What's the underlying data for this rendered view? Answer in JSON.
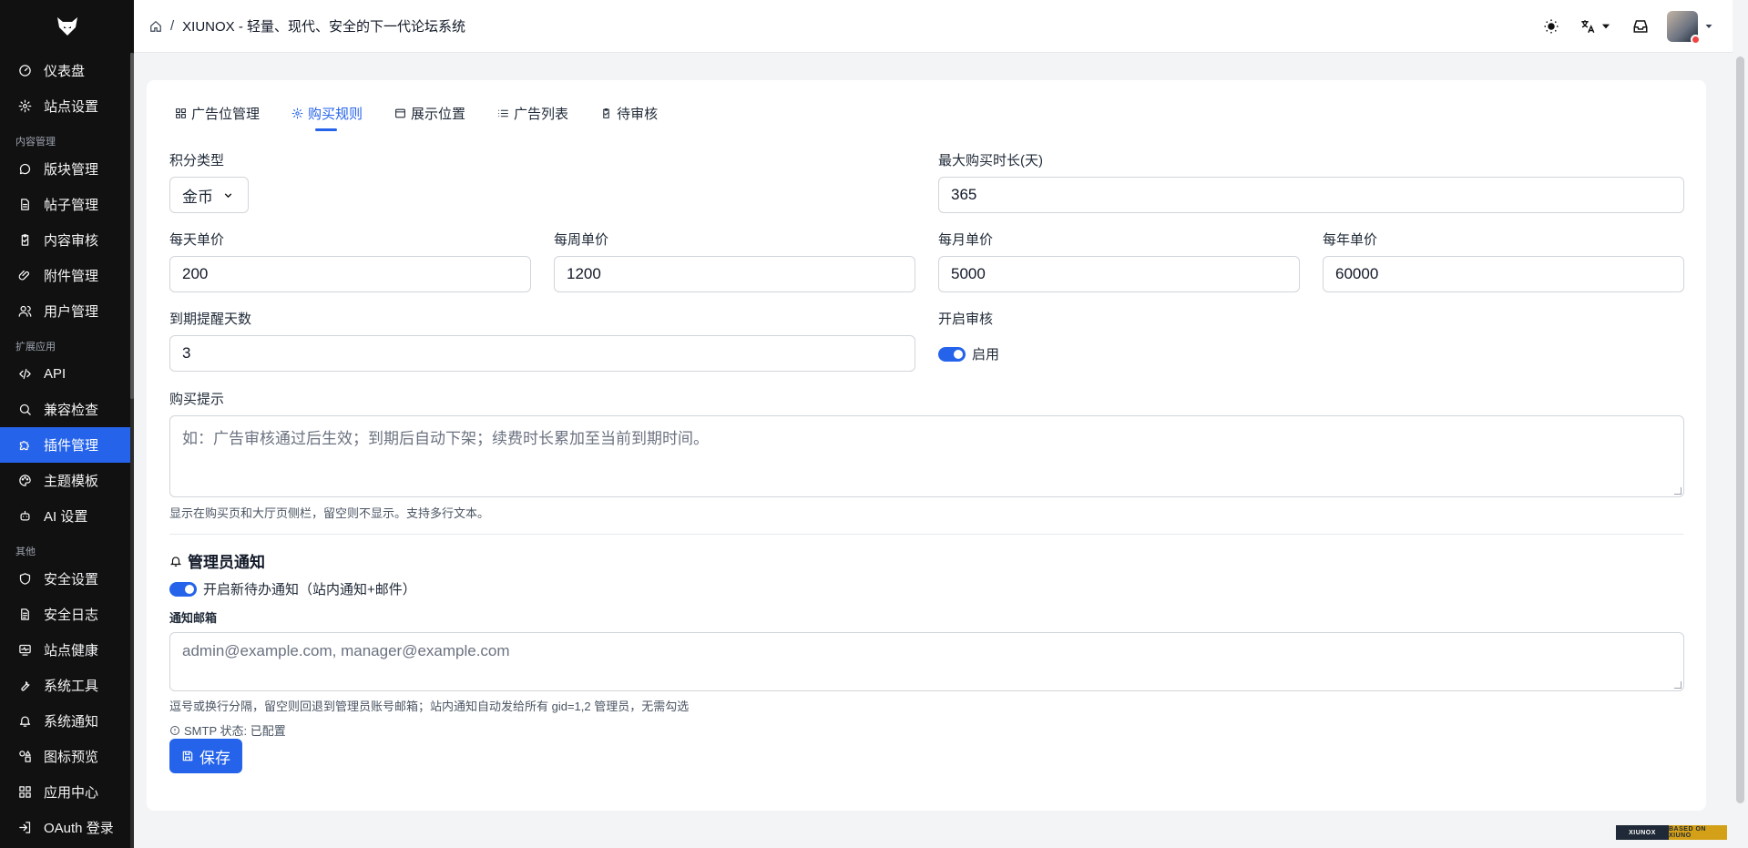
{
  "sidebar": {
    "items_top": [
      {
        "label": "仪表盘",
        "icon": "dashboard-icon"
      },
      {
        "label": "站点设置",
        "icon": "gear-icon"
      }
    ],
    "group_content": "内容管理",
    "items_content": [
      {
        "label": "版块管理",
        "icon": "chat-bubble-icon"
      },
      {
        "label": "帖子管理",
        "icon": "document-icon"
      },
      {
        "label": "内容审核",
        "icon": "clipboard-check-icon"
      },
      {
        "label": "附件管理",
        "icon": "paperclip-icon"
      },
      {
        "label": "用户管理",
        "icon": "users-icon"
      }
    ],
    "group_ext": "扩展应用",
    "items_ext": [
      {
        "label": "API",
        "icon": "code-icon"
      },
      {
        "label": "兼容检查",
        "icon": "search-icon"
      },
      {
        "label": "插件管理",
        "icon": "puzzle-icon",
        "active": true
      },
      {
        "label": "主题模板",
        "icon": "palette-icon"
      },
      {
        "label": "AI 设置",
        "icon": "robot-icon"
      }
    ],
    "group_other": "其他",
    "items_other": [
      {
        "label": "安全设置",
        "icon": "shield-icon"
      },
      {
        "label": "安全日志",
        "icon": "log-icon"
      },
      {
        "label": "站点健康",
        "icon": "monitor-heart-icon"
      },
      {
        "label": "系统工具",
        "icon": "wrench-icon"
      },
      {
        "label": "系统通知",
        "icon": "bell-icon"
      },
      {
        "label": "图标预览",
        "icon": "shapes-icon"
      },
      {
        "label": "应用中心",
        "icon": "apps-icon"
      },
      {
        "label": "OAuth 登录",
        "icon": "login-icon"
      }
    ]
  },
  "header": {
    "breadcrumb_sep": "/",
    "title": "XIUNOX - 轻量、现代、安全的下一代论坛系统"
  },
  "tabs": [
    {
      "label": "广告位管理",
      "icon": "grid-icon"
    },
    {
      "label": "购买规则",
      "icon": "gear-icon",
      "active": true
    },
    {
      "label": "展示位置",
      "icon": "window-icon"
    },
    {
      "label": "广告列表",
      "icon": "list-icon"
    },
    {
      "label": "待审核",
      "icon": "clipboard-check-icon"
    }
  ],
  "form": {
    "points_type": {
      "label": "积分类型",
      "value": "金币"
    },
    "max_duration": {
      "label": "最大购买时长(天)",
      "value": "365"
    },
    "daily_price": {
      "label": "每天单价",
      "value": "200"
    },
    "weekly_price": {
      "label": "每周单价",
      "value": "1200"
    },
    "monthly_price": {
      "label": "每月单价",
      "value": "5000"
    },
    "yearly_price": {
      "label": "每年单价",
      "value": "60000"
    },
    "expire_remind_days": {
      "label": "到期提醒天数",
      "value": "3"
    },
    "enable_review": {
      "label": "开启审核",
      "toggle_label": "启用",
      "on": true
    },
    "purchase_tip": {
      "label": "购买提示",
      "placeholder": "如：广告审核通过后生效；到期后自动下架；续费时长累加至当前到期时间。",
      "help": "显示在购买页和大厅页侧栏，留空则不显示。支持多行文本。"
    }
  },
  "admin_notify": {
    "title": "管理员通知",
    "toggle_label": "开启新待办通知（站内通知+邮件）",
    "email_label": "通知邮箱",
    "email_placeholder": "admin@example.com, manager@example.com",
    "email_help": "逗号或换行分隔，留空则回退到管理员账号邮箱；站内通知自动发给所有 gid=1,2 管理员，无需勾选",
    "smtp_status": "SMTP 状态: 已配置"
  },
  "save_label": "保存",
  "badge": {
    "left": "XIUNOX",
    "right": "BASED ON XIUNO"
  },
  "colors": {
    "accent": "#2563eb",
    "sidebar_bg": "#111111"
  }
}
